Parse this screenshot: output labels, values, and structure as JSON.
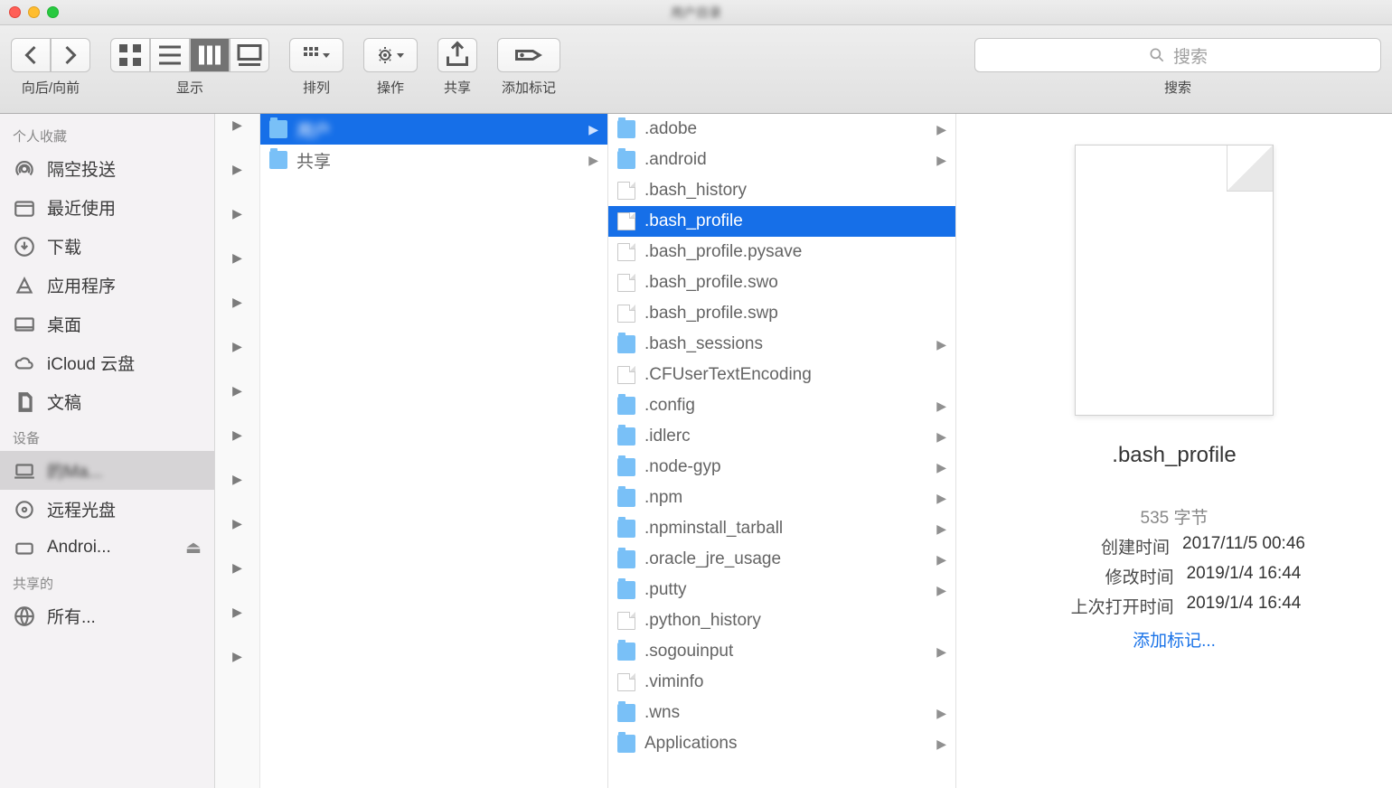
{
  "window_title": "用户目录",
  "toolbar": {
    "nav_label": "向后/向前",
    "view_label": "显示",
    "arrange_label": "排列",
    "action_label": "操作",
    "share_label": "共享",
    "tag_label": "添加标记",
    "search_label": "搜索",
    "search_placeholder": "搜索"
  },
  "sidebar": {
    "sections": [
      {
        "title": "个人收藏",
        "items": [
          {
            "icon": "airdrop",
            "label": "隔空投送"
          },
          {
            "icon": "recent",
            "label": "最近使用"
          },
          {
            "icon": "download",
            "label": "下载"
          },
          {
            "icon": "app",
            "label": "应用程序"
          },
          {
            "icon": "desktop",
            "label": "桌面"
          },
          {
            "icon": "cloud",
            "label": "iCloud 云盘"
          },
          {
            "icon": "docs",
            "label": "文稿"
          }
        ]
      },
      {
        "title": "设备",
        "items": [
          {
            "icon": "laptop",
            "label": "的Ma...",
            "selected": true,
            "blur": true
          },
          {
            "icon": "disc",
            "label": "远程光盘"
          },
          {
            "icon": "drive",
            "label": "Androi...",
            "eject": true
          }
        ]
      },
      {
        "title": "共享的",
        "items": [
          {
            "icon": "globe",
            "label": "所有..."
          }
        ]
      }
    ]
  },
  "col1": [
    {
      "type": "folder",
      "label": "用户",
      "exp": true,
      "selected": true,
      "blur": true
    },
    {
      "type": "folder",
      "label": "共享",
      "exp": true
    }
  ],
  "col2": [
    {
      "type": "folder",
      "label": ".adobe",
      "exp": true
    },
    {
      "type": "folder",
      "label": ".android",
      "exp": true
    },
    {
      "type": "doc",
      "label": ".bash_history"
    },
    {
      "type": "doc",
      "label": ".bash_profile",
      "selected": true
    },
    {
      "type": "doc",
      "label": ".bash_profile.pysave"
    },
    {
      "type": "doc",
      "label": ".bash_profile.swo"
    },
    {
      "type": "doc",
      "label": ".bash_profile.swp"
    },
    {
      "type": "folder",
      "label": ".bash_sessions",
      "exp": true
    },
    {
      "type": "doc",
      "label": ".CFUserTextEncoding"
    },
    {
      "type": "folder",
      "label": ".config",
      "exp": true
    },
    {
      "type": "folder",
      "label": ".idlerc",
      "exp": true
    },
    {
      "type": "folder",
      "label": ".node-gyp",
      "exp": true
    },
    {
      "type": "folder",
      "label": ".npm",
      "exp": true
    },
    {
      "type": "folder",
      "label": ".npminstall_tarball",
      "exp": true
    },
    {
      "type": "folder",
      "label": ".oracle_jre_usage",
      "exp": true
    },
    {
      "type": "folder",
      "label": ".putty",
      "exp": true
    },
    {
      "type": "doc",
      "label": ".python_history"
    },
    {
      "type": "folder",
      "label": ".sogouinput",
      "exp": true
    },
    {
      "type": "doc",
      "label": ".viminfo"
    },
    {
      "type": "folder",
      "label": ".wns",
      "exp": true
    },
    {
      "type": "folder",
      "label": "Applications",
      "exp": true
    }
  ],
  "preview": {
    "name": ".bash_profile",
    "size": "535 字节",
    "created_k": "创建时间",
    "created_v": "2017/11/5 00:46",
    "modified_k": "修改时间",
    "modified_v": "2019/1/4 16:44",
    "opened_k": "上次打开时间",
    "opened_v": "2019/1/4 16:44",
    "addtag": "添加标记..."
  }
}
